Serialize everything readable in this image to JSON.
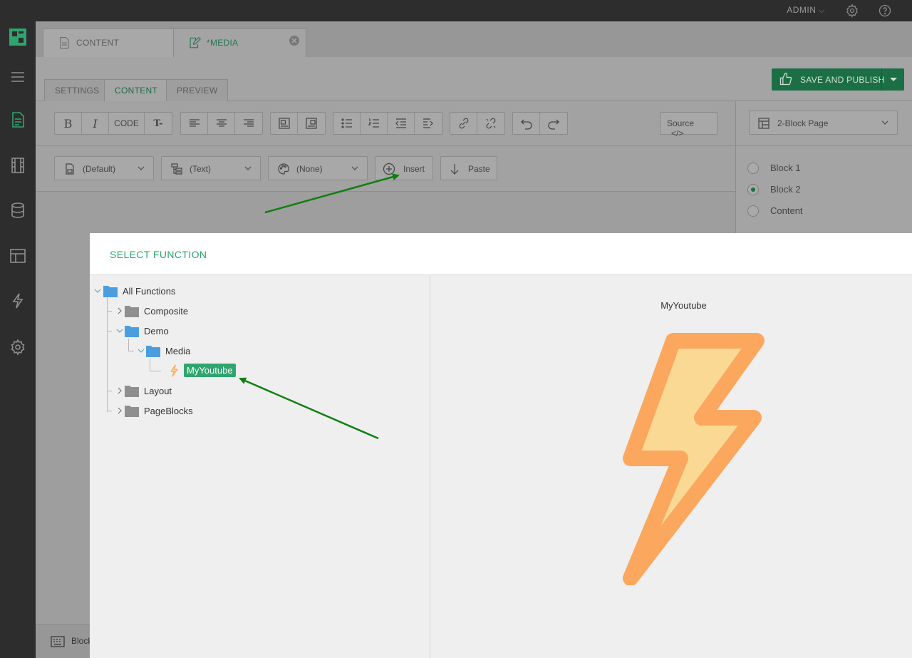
{
  "topbar": {
    "user": "ADMIN"
  },
  "doc_tabs": [
    {
      "label": "CONTENT"
    },
    {
      "label": "*MEDIA"
    }
  ],
  "sub_tabs": [
    {
      "label": "SETTINGS"
    },
    {
      "label": "CONTENT"
    },
    {
      "label": "PREVIEW"
    }
  ],
  "save_button": {
    "label": "SAVE AND PUBLISH"
  },
  "toolbar": {
    "bold": "B",
    "italic": "I",
    "code": "CODE",
    "clear_format": "T-",
    "source": "Source"
  },
  "format_bar": {
    "style_select": "(Default)",
    "element_select": "(Text)",
    "class_select": "(None)",
    "insert_label": "Insert",
    "paste_label": "Paste"
  },
  "side_panel": {
    "template_select": "2-Block Page",
    "blocks": [
      {
        "label": "Block 1",
        "selected": false
      },
      {
        "label": "Block 2",
        "selected": true
      },
      {
        "label": "Content",
        "selected": false
      }
    ]
  },
  "bottom_strip": {
    "label": "Block"
  },
  "dialog": {
    "title": "SELECT FUNCTION",
    "tree": {
      "root": "All Functions",
      "composite": "Composite",
      "demo": "Demo",
      "media": "Media",
      "selected_function": "MyYoutube",
      "layout": "Layout",
      "pageblocks": "PageBlocks"
    },
    "preview_title": "MyYoutube"
  },
  "colors": {
    "accent": "#2fa56e",
    "bolt_fill": "#f9d994",
    "bolt_stroke": "#fba75e",
    "annotation_arrow": "#0f7f0f"
  }
}
